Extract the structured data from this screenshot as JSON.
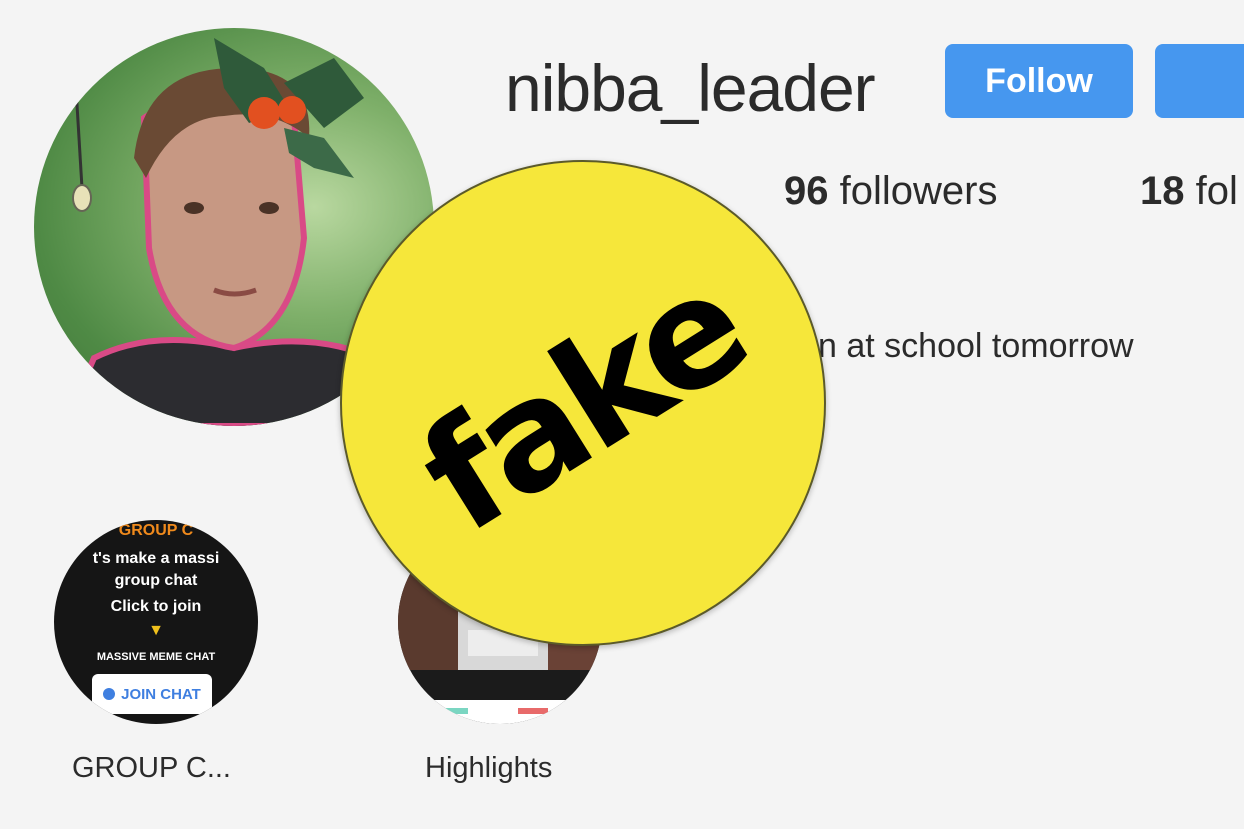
{
  "profile": {
    "username": "nibba_leader",
    "follow_label": "Follow",
    "followers_count": "96",
    "followers_label": "followers",
    "following_count": "18",
    "following_label": "fol",
    "bio": "n at school tomorrow"
  },
  "highlights": [
    {
      "label": "GROUP C...",
      "cover_lines": [
        "GROUP C",
        "t's make a massi",
        "group chat",
        "Click to join",
        "MASSIVE MEME CHAT"
      ],
      "join_label": "JOIN CHAT"
    },
    {
      "label": "Highlights"
    }
  ],
  "overlay": {
    "badge_text": "fake"
  },
  "colors": {
    "accent": "#4697ef",
    "badge": "#f6e73a"
  }
}
